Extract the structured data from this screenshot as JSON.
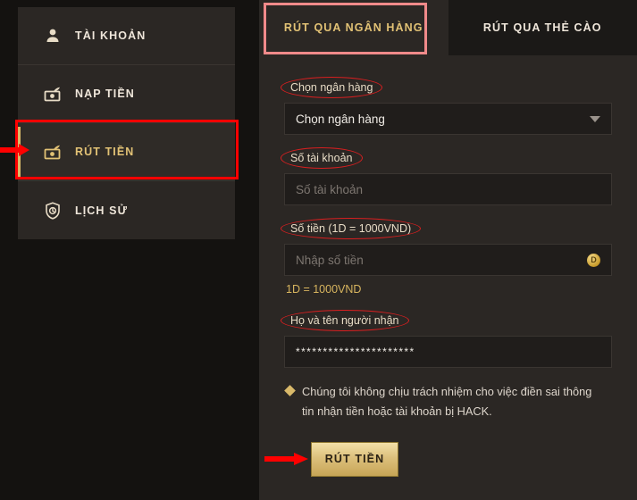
{
  "sidebar": {
    "items": [
      {
        "label": "TÀI KHOẢN",
        "icon": "user-icon",
        "active": false
      },
      {
        "label": "NẠP TIỀN",
        "icon": "deposit-money-icon",
        "active": false
      },
      {
        "label": "RÚT TIỀN",
        "icon": "withdraw-money-icon",
        "active": true
      },
      {
        "label": "LỊCH SỬ",
        "icon": "history-shield-icon",
        "active": false
      }
    ]
  },
  "tabs": [
    {
      "label": "RÚT QUA NGÂN HÀNG",
      "active": true
    },
    {
      "label": "RÚT QUA THẺ CÀO",
      "active": false
    }
  ],
  "form": {
    "bank": {
      "label": "Chọn ngân hàng",
      "selected": "Chọn ngân hàng",
      "icon": "chevron-down-icon"
    },
    "account_number": {
      "label": "Số tài khoản",
      "placeholder": "Số tài khoản",
      "value": ""
    },
    "amount": {
      "label": "Số tiền (1D = 1000VND)",
      "placeholder": "Nhập số tiền",
      "value": "",
      "coin_icon_text": "D",
      "rate_note": "1D = 1000VND"
    },
    "recipient": {
      "label": "Họ và tên người nhận",
      "value": "**********************"
    },
    "warning": "Chúng tôi không chịu trách nhiệm cho việc điền sai thông tin nhận tiền hoặc tài khoản bị HACK.",
    "submit_label": "RÚT TIỀN"
  },
  "colors": {
    "gold": "#d9b96a",
    "gold_text": "#e2c275",
    "panel_bg": "#2b2724",
    "page_bg": "#141210",
    "input_bg": "#201d1b",
    "highlight_red": "#ff0000",
    "highlight_pink": "#f08a8a",
    "annotation_red": "#d81f20"
  }
}
